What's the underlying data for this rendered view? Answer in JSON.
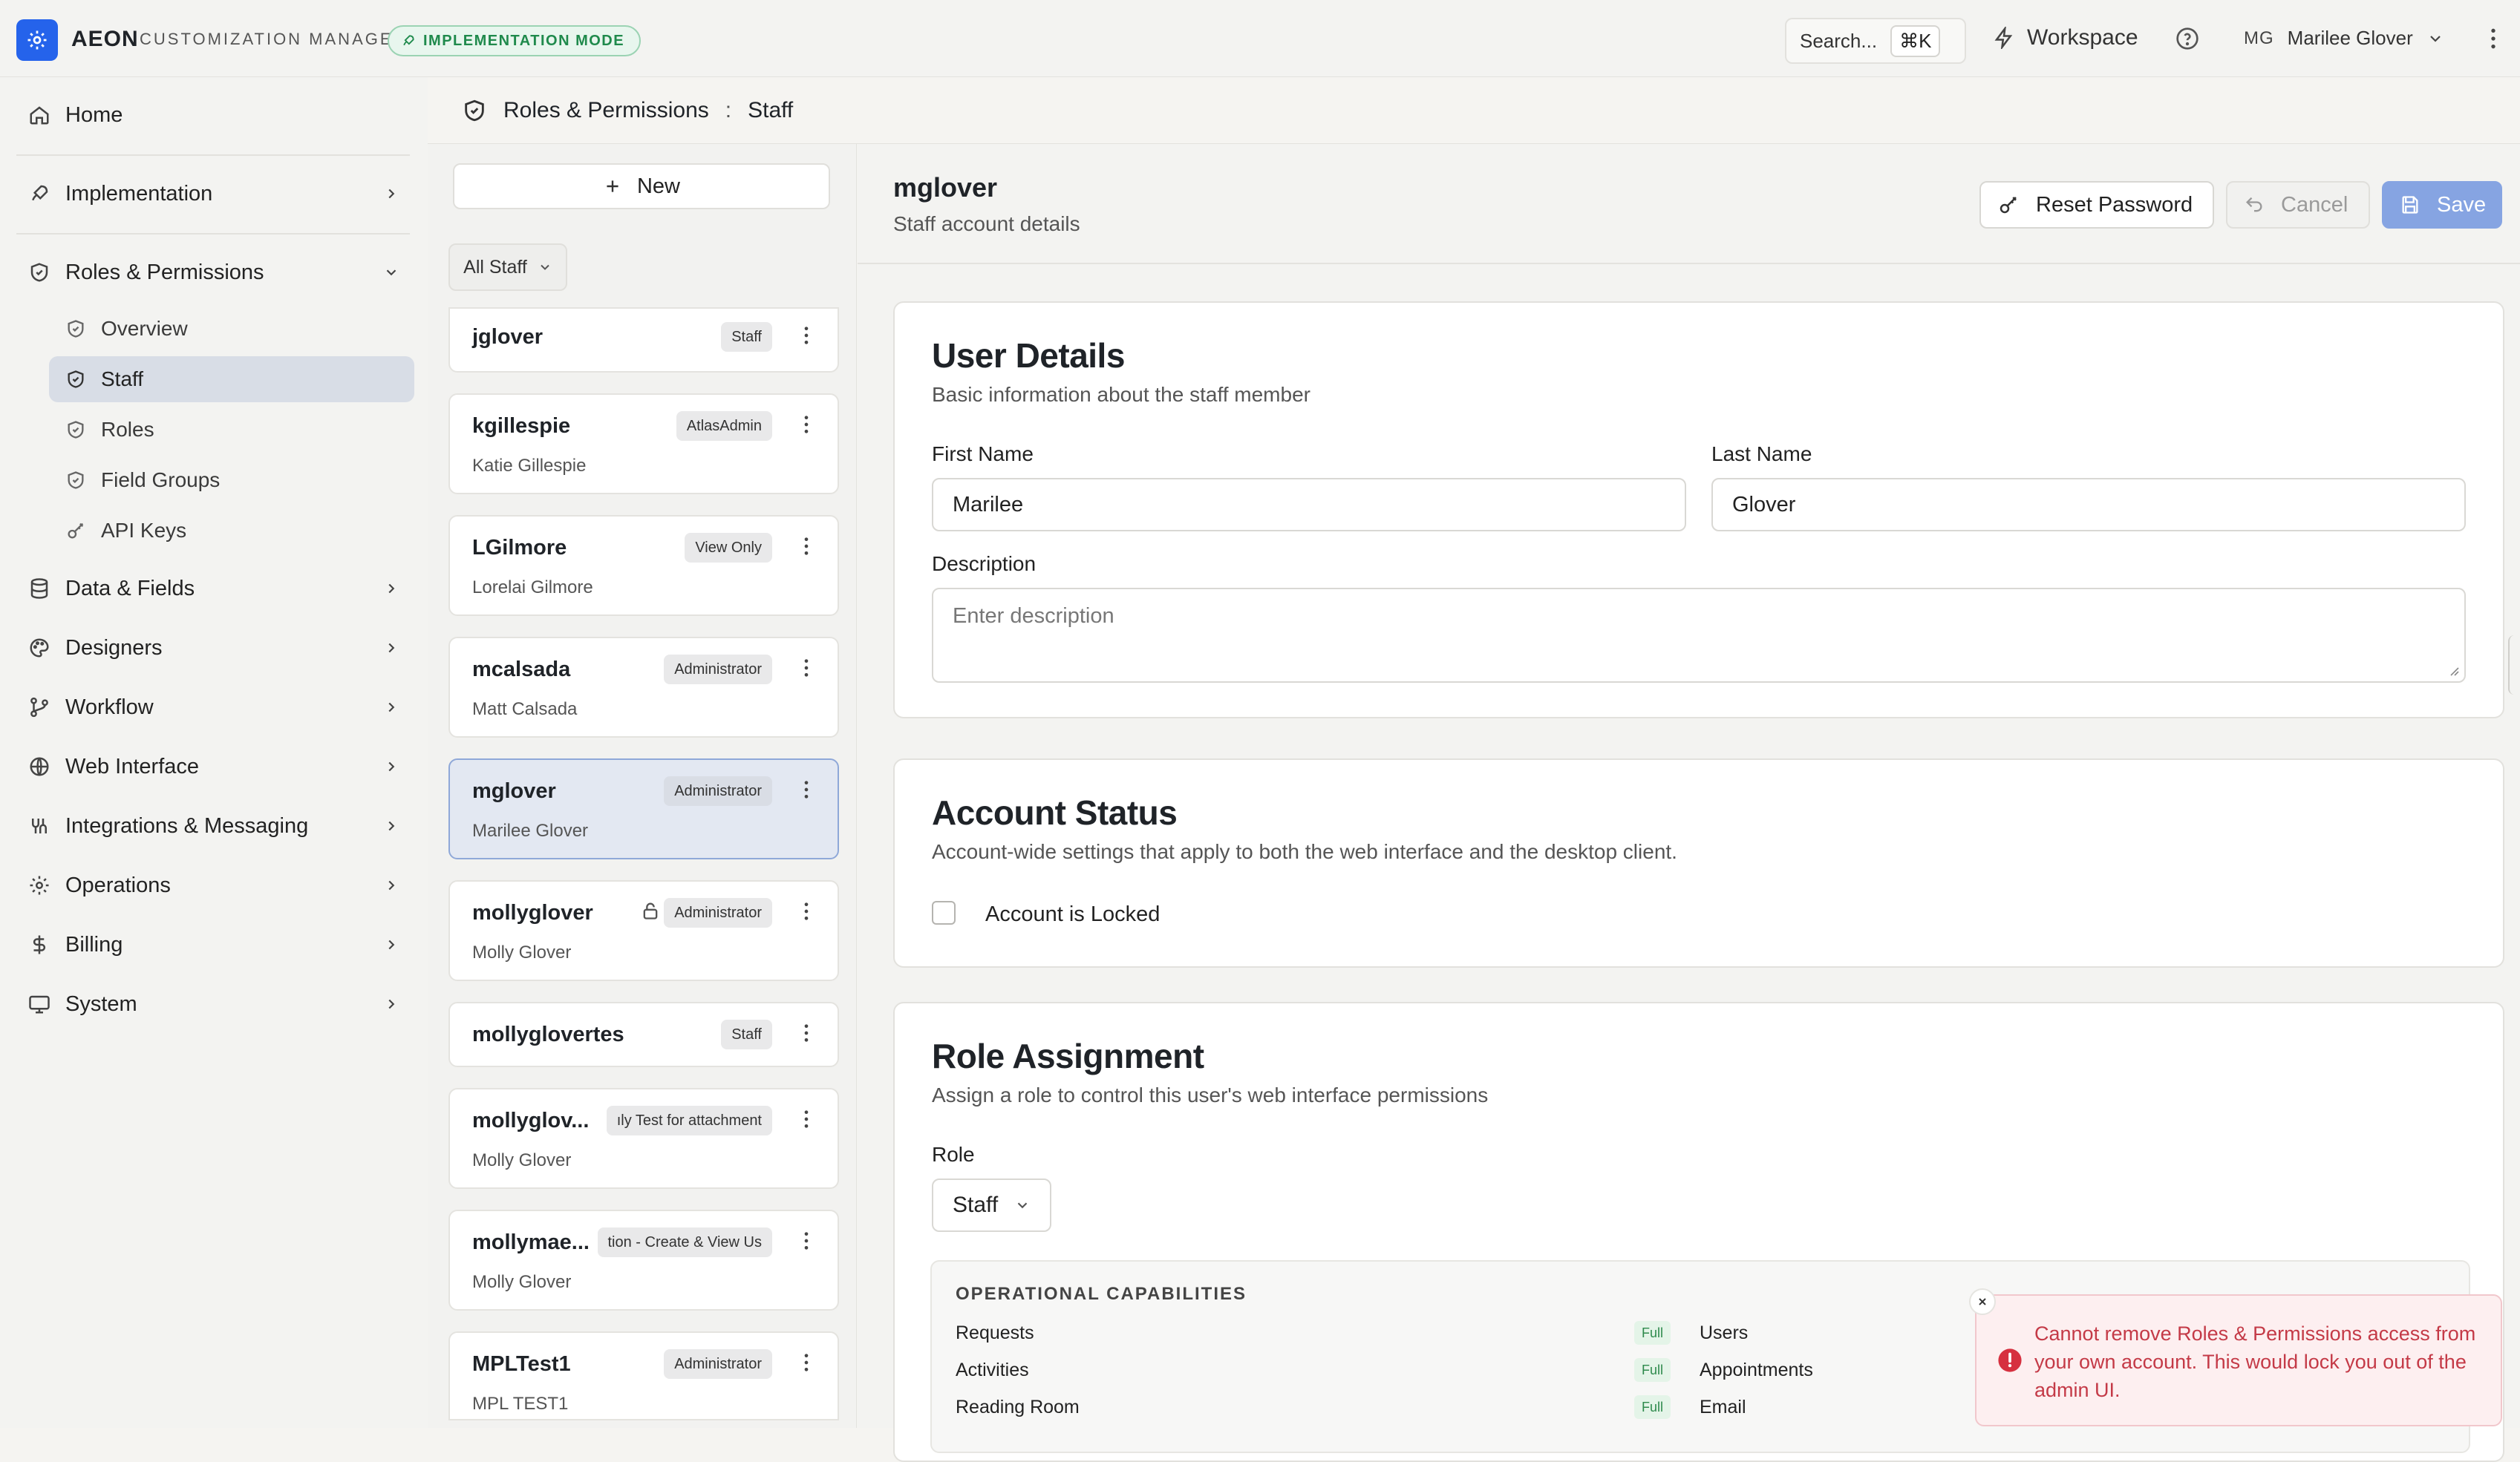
{
  "topbar": {
    "brand": "AEON",
    "brand_sub": "CUSTOMIZATION MANAGER",
    "mode_badge": "IMPLEMENTATION MODE",
    "search_placeholder": "Search...",
    "search_shortcut": "⌘K",
    "workspace_label": "Workspace",
    "user_initials": "MG",
    "user_name": "Marilee Glover"
  },
  "sidebar": {
    "home": "Home",
    "implementation": "Implementation",
    "roles_permissions": "Roles & Permissions",
    "sub": [
      "Overview",
      "Staff",
      "Roles",
      "Field Groups",
      "API Keys"
    ],
    "active_sub": "Staff",
    "items": [
      "Data & Fields",
      "Designers",
      "Workflow",
      "Web Interface",
      "Integrations & Messaging",
      "Operations",
      "Billing",
      "System"
    ]
  },
  "breadcrumb": {
    "section": "Roles & Permissions",
    "sep": ":",
    "current": "Staff"
  },
  "list": {
    "new_label": "New",
    "filter_label": "All Staff",
    "users": [
      {
        "username": "jglover",
        "fullname": "",
        "badge": "Staff"
      },
      {
        "username": "kgillespie",
        "fullname": "Katie Gillespie",
        "badge": "AtlasAdmin"
      },
      {
        "username": "LGilmore",
        "fullname": "Lorelai Gilmore",
        "badge": "View Only"
      },
      {
        "username": "mcalsada",
        "fullname": "Matt Calsada",
        "badge": "Administrator"
      },
      {
        "username": "mglover",
        "fullname": "Marilee Glover",
        "badge": "Administrator"
      },
      {
        "username": "mollyglover",
        "fullname": "Molly Glover",
        "badge": "Administrator"
      },
      {
        "username": "mollyglovertes",
        "fullname": "",
        "badge": "Staff"
      },
      {
        "username": "mollyglov...",
        "fullname": "Molly Glover",
        "badge": "ıly Test for attachment"
      },
      {
        "username": "mollymae...",
        "fullname": "Molly Glover",
        "badge": "tion - Create & View Us"
      },
      {
        "username": "MPLTest1",
        "fullname": "MPL TEST1",
        "badge": "Administrator"
      }
    ]
  },
  "detail": {
    "title": "mglover",
    "subtitle": "Staff account details",
    "reset_label": "Reset Password",
    "cancel_label": "Cancel",
    "save_label": "Save",
    "user_details": {
      "title": "User Details",
      "desc": "Basic information about the staff member",
      "first_name_label": "First Name",
      "first_name": "Marilee",
      "last_name_label": "Last Name",
      "last_name": "Glover",
      "description_label": "Description",
      "description_placeholder": "Enter description"
    },
    "account_status": {
      "title": "Account Status",
      "desc": "Account-wide settings that apply to both the web interface and the desktop client.",
      "locked_label": "Account is Locked"
    },
    "role_assignment": {
      "title": "Role Assignment",
      "desc": "Assign a role to control this user's web interface permissions",
      "role_label": "Role",
      "role_value": "Staff",
      "ops_title": "OPERATIONAL CAPABILITIES",
      "ops_left": [
        "Requests",
        "Activities",
        "Reading Room"
      ],
      "ops_right": [
        "Users",
        "Appointments",
        "Email"
      ],
      "full_label": "Full"
    }
  },
  "toast": {
    "message": "Cannot remove Roles & Permissions access from your own account. This would lock you out of the admin UI."
  }
}
